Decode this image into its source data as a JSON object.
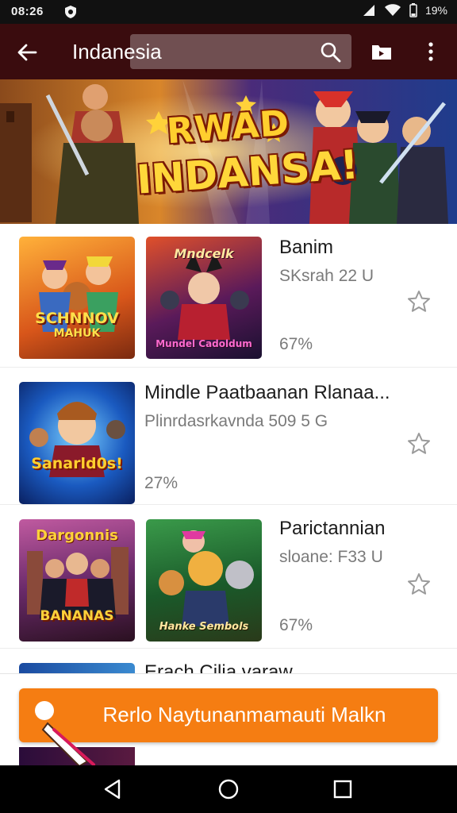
{
  "status_bar": {
    "time": "08:26",
    "battery": "19%"
  },
  "app_bar": {
    "title": "Indanesia"
  },
  "banner": {
    "line1": "RWAD",
    "line2": "INDANSA!"
  },
  "items": [
    {
      "title": "Banim",
      "subtitle": "SKsrah 22 U",
      "percent": "67%",
      "thumb1_text": "SCHNNOV",
      "thumb1_text2": "MAHUK",
      "thumb2_text_top": "Mndcelk",
      "thumb2_text_bottom": "Mundel Cadoldum"
    },
    {
      "title": "Mindle Paatbaanan Rlanaa...",
      "subtitle": "Plinrdasrkavnda 509 5 G",
      "percent": "27%",
      "thumb1_text": "Sanarld0s!"
    },
    {
      "title": "Parictannian",
      "subtitle": "sloane: F33 U",
      "percent": "67%",
      "thumb1_text": "Dargonnis",
      "thumb1_text2": "BANANAS",
      "thumb2_text_bottom": "Hanke Sembols"
    },
    {
      "title": "Erach Cilia varaw"
    }
  ],
  "action_button": {
    "label": "Rerlo Naytunanmamauti Malkn"
  },
  "colors": {
    "app_bar": "#3a0c0e",
    "accent": "#f57d12",
    "status_bar": "#111111"
  },
  "icons": [
    "back-arrow-icon",
    "search-icon",
    "cast-icon",
    "more-vert-icon",
    "star-icon",
    "nav-back-icon",
    "nav-home-icon",
    "nav-recents-icon",
    "wifi-icon",
    "signal-icon",
    "battery-icon"
  ]
}
